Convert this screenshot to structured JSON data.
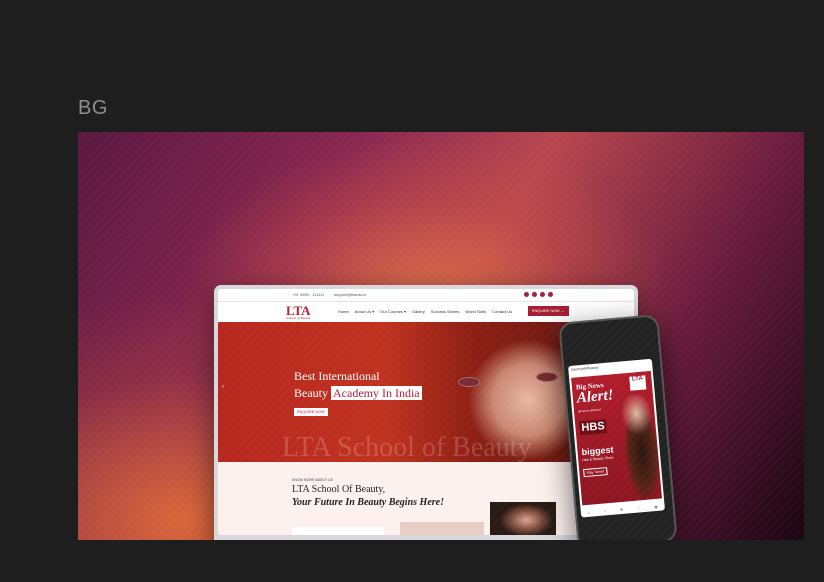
{
  "frame": {
    "label": "BG"
  },
  "site": {
    "topbar": {
      "phone": "+91 0000 - 111111",
      "email": "support@ltaedu.in"
    },
    "logo": {
      "text": "LTA",
      "sub": "School of Beauty"
    },
    "menu": [
      "Home",
      "About Us ▾",
      "Our Courses ▾",
      "Gallery",
      "Success Stories",
      "World Skills",
      "Contact Us"
    ],
    "enquire": "ENQUIRE NOW →",
    "hero": {
      "line1": "Best International",
      "line2_pre": "Beauty ",
      "line2_highlight": "Academy In India",
      "button": "ENQUIRE NOW",
      "arrow": "‹",
      "watermark": "LTA School of Beauty"
    },
    "about": {
      "kicker": "KNOW MORE ABOUT US",
      "title": "LTA School Of Beauty,",
      "tagline": "Your Future In Beauty Begins Here!"
    }
  },
  "mobile": {
    "header": "ltaschoolofbeauty",
    "ad": {
      "big_news": "Big News",
      "alert": "Alert!",
      "sub": "all set to debut at",
      "hbs": "HBS",
      "biggest": "biggest",
      "show": "Hair & Beauty Show",
      "cta": "Stay Tuned",
      "logo": "LTA"
    },
    "nav": [
      "⌂",
      "⌕",
      "⊕",
      "♡",
      "◉"
    ]
  },
  "colors": {
    "brand": "#b3203a",
    "background": "#1e1e1e"
  }
}
